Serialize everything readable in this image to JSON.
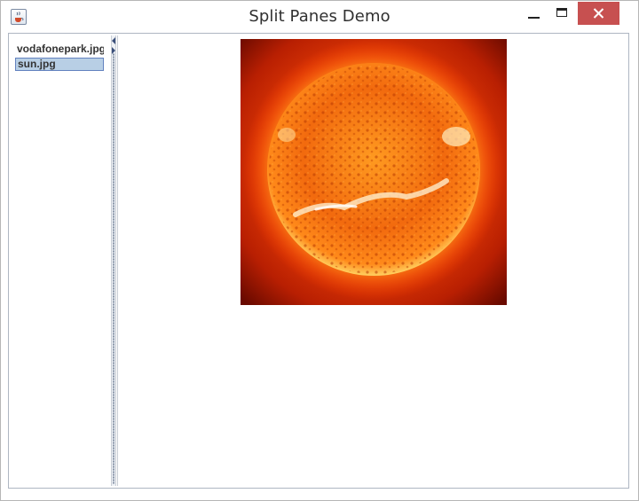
{
  "window": {
    "title": "Split Panes Demo"
  },
  "icons": {
    "app": "java-cup-icon",
    "minimize": "minimize-icon",
    "maximize": "maximize-icon",
    "close": "close-icon"
  },
  "colors": {
    "close_button": "#c75050",
    "selection_bg": "#b8cfe5",
    "selection_border": "#6382bf"
  },
  "list": {
    "items": [
      {
        "label": "vodafonepark.jpg",
        "selected": false
      },
      {
        "label": "sun.jpg",
        "selected": true
      }
    ]
  },
  "preview": {
    "image": "sun"
  }
}
